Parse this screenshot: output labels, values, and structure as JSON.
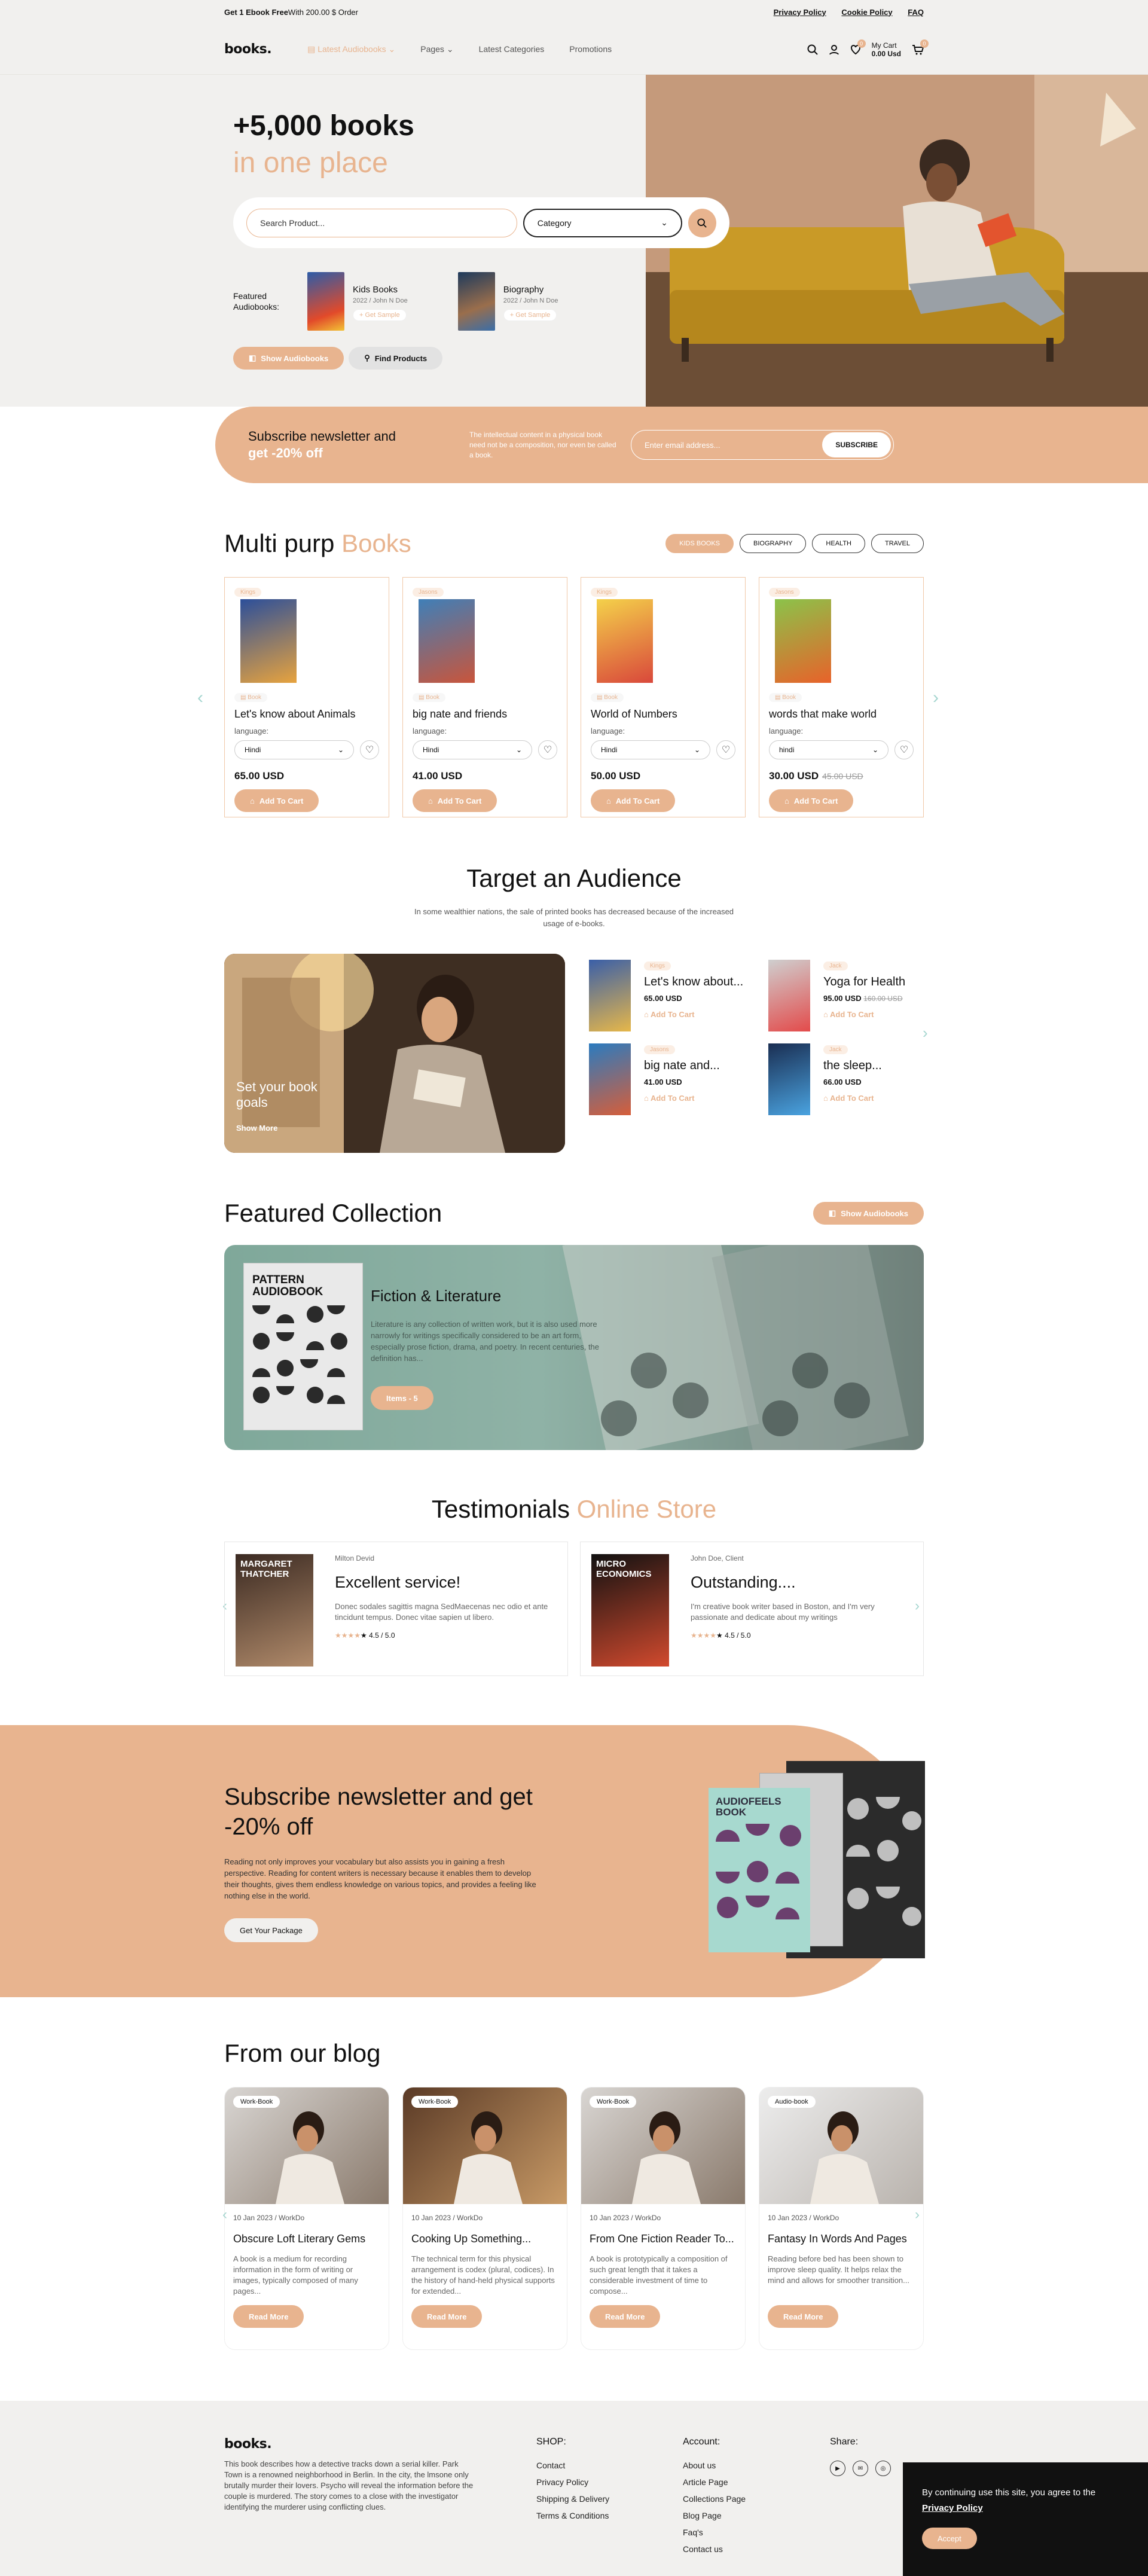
{
  "topbar": {
    "promo_bold": "Get 1 Ebook Free",
    "promo_rest": "With 200.00 $ Order",
    "links": [
      "Privacy Policy",
      "Cookie Policy",
      "FAQ"
    ]
  },
  "nav": {
    "logo": "books.",
    "menu": [
      "Latest Audiobooks",
      "Pages",
      "Latest Categories",
      "Promotions"
    ],
    "cart_label": "My Cart",
    "cart_total": "0.00 Usd",
    "wish_count": "0",
    "cart_count": "0"
  },
  "hero": {
    "title": "+5,000 books",
    "subtitle": "in one place",
    "search_placeholder": "Search Product...",
    "category": "Category",
    "featured_label": "Featured Audiobooks:",
    "featured": [
      {
        "title": "Kids Books",
        "meta": "2022 / John N Doe",
        "sample": "Get Sample"
      },
      {
        "title": "Biography",
        "meta": "2022 / John N Doe",
        "sample": "Get Sample"
      }
    ],
    "btn_audio": "Show Audiobooks",
    "btn_find": "Find Products"
  },
  "newsletter": {
    "title": "Subscribe newsletter and",
    "offer": "get -20% off",
    "text": "The intellectual content in a physical book need not be a composition, nor even be called a book.",
    "placeholder": "Enter email address...",
    "button": "SUBSCRIBE"
  },
  "multi": {
    "title": "Multi purp ",
    "title_accent": "Books",
    "tags": [
      "KIDS BOOKS",
      "BIOGRAPHY",
      "HEALTH",
      "TRAVEL"
    ],
    "products": [
      {
        "tag": "Kings",
        "type": "Book",
        "name": "Let's know about Animals",
        "language_label": "language:",
        "language": "Hindi",
        "price": "65.00 USD",
        "old": "",
        "cart": "Add To Cart"
      },
      {
        "tag": "Jasons",
        "type": "Book",
        "name": "big nate and friends",
        "language_label": "language:",
        "language": "Hindi",
        "price": "41.00 USD",
        "old": "",
        "cart": "Add To Cart"
      },
      {
        "tag": "Kings",
        "type": "Book",
        "name": "World of Numbers",
        "language_label": "language:",
        "language": "Hindi",
        "price": "50.00 USD",
        "old": "",
        "cart": "Add To Cart"
      },
      {
        "tag": "Jasons",
        "type": "Book",
        "name": "words that make world",
        "language_label": "language:",
        "language": "hindi",
        "price": "30.00 USD",
        "old": "45.00 USD",
        "cart": "Add To Cart"
      }
    ]
  },
  "audience": {
    "title": "Target an Audience",
    "text": "In some wealthier nations, the sale of printed books has decreased because of the increased usage of e-books.",
    "banner_title": "Set your book goals",
    "banner_link": "Show More",
    "books": [
      {
        "tag": "Kings",
        "title": "Let's know about...",
        "price": "65.00 USD",
        "old": "",
        "cart": "Add To Cart"
      },
      {
        "tag": "Jack",
        "title": "Yoga for Health",
        "price": "95.00 USD",
        "old": "160.00 USD",
        "cart": "Add To Cart"
      },
      {
        "tag": "Jasons",
        "title": "big nate and...",
        "price": "41.00 USD",
        "old": "",
        "cart": "Add To Cart"
      },
      {
        "tag": "Jack",
        "title": "the sleep...",
        "price": "66.00 USD",
        "old": "",
        "cart": "Add To Cart"
      }
    ]
  },
  "featured": {
    "title": "Featured Collection",
    "button": "Show Audiobooks",
    "card_title": "Fiction & Literature",
    "card_text": "Literature is any collection of written work, but it is also used more narrowly for writings specifically considered to be an art form, especially prose fiction, drama, and poetry. In recent centuries, the definition has...",
    "card_button": "Items - 5",
    "cover_text": "PATTERN AUDIOBOOK"
  },
  "testimonials": {
    "title": "Testimonials ",
    "title_accent": "Online Store",
    "items": [
      {
        "author": "Milton Devid",
        "heading": "Excellent service!",
        "text": "Donec sodales sagittis magna SedMaecenas nec odio et ante tincidunt tempus. Donec vitae sapien ut libero.",
        "rating": "4.5 / 5.0",
        "cover": "MARGARET THATCHER"
      },
      {
        "author": "John Doe, Client",
        "heading": "Outstanding....",
        "text": "I'm creative book writer based in Boston, and I'm very passionate and dedicate about my writings",
        "rating": "4.5 / 5.0",
        "cover": "MICRO ECONOMICS"
      }
    ]
  },
  "promo": {
    "title": "Subscribe newsletter and get -20% off",
    "text": "Reading not only improves your vocabulary but also assists you in gaining a fresh perspective. Reading for content writers is necessary because it enables them to develop their thoughts, gives them endless knowledge on various topics, and provides a feeling like nothing else in the world.",
    "button": "Get Your Package",
    "book_text": "AUDIOFEELS BOOK"
  },
  "blog": {
    "title": "From our blog",
    "posts": [
      {
        "tag": "Work-Book",
        "date": "10 Jan 2023 / WorkDo",
        "title": "Obscure Loft Literary Gems",
        "text": "A book is a medium for recording information in the form of writing or images, typically composed of many pages...",
        "button": "Read More"
      },
      {
        "tag": "Work-Book",
        "date": "10 Jan 2023 / WorkDo",
        "title": "Cooking Up Something...",
        "text": "The technical term for this physical arrangement is codex (plural, codices). In the history of hand-held physical supports for extended...",
        "button": "Read More"
      },
      {
        "tag": "Work-Book",
        "date": "10 Jan 2023 / WorkDo",
        "title": "From One Fiction Reader To...",
        "text": "A book is prototypically a composition of such great length that it takes a considerable investment of time to compose...",
        "button": "Read More"
      },
      {
        "tag": "Audio-book",
        "date": "10 Jan 2023 / WorkDo",
        "title": "Fantasy In Words And Pages",
        "text": "Reading before bed has been shown to improve sleep quality. It helps relax the mind and allows for smoother transition...",
        "button": "Read More"
      }
    ]
  },
  "footer": {
    "logo": "books.",
    "about": "This book describes how a detective tracks down a serial killer. Park Town is a renowned neighborhood in Berlin. In the city, the lmsone only brutally murder their lovers. Psycho will reveal the information before the couple is murdered. The story comes to a close with the investigator identifying the murderer using conflicting clues.",
    "shop_title": "SHOP:",
    "shop": [
      "Contact",
      "Privacy Policy",
      "Shipping & Delivery",
      "Terms & Conditions"
    ],
    "account_title": "Account:",
    "account": [
      "About us",
      "Article Page",
      "Collections Page",
      "Blog Page",
      "Faq's",
      "Contact us"
    ],
    "share_title": "Share:"
  },
  "cookie": {
    "text": "By continuing use this site, you agree to the",
    "link": "Privacy Policy",
    "button": "Accept"
  },
  "colors": {
    "accent": "#e8b48f",
    "bg": "#f1f0ee",
    "teal": "#7fa89a"
  }
}
